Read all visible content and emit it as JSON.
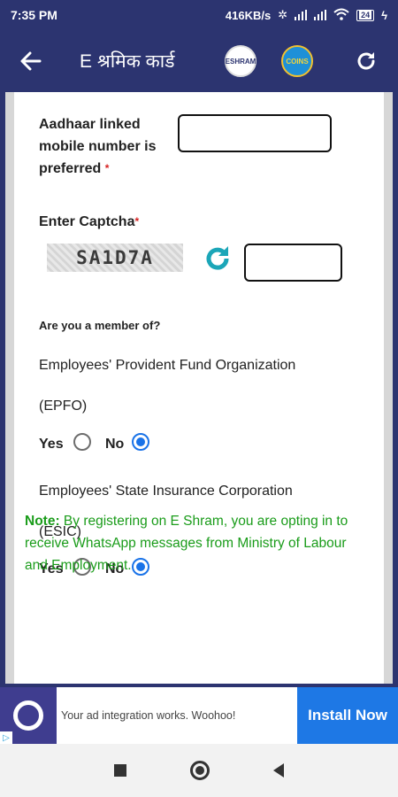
{
  "status_bar": {
    "time": "7:35 PM",
    "net_speed": "416KB/s",
    "battery": "24"
  },
  "app_bar": {
    "title": "E श्रमिक कार्ड",
    "logo_1_text": "ESHRAM",
    "logo_2_text": "COINS"
  },
  "form": {
    "mobile_label": "Aadhaar linked mobile number is preferred",
    "mobile_value": "",
    "captcha_label": "Enter Captcha",
    "captcha_text": "SA1D7A",
    "captcha_value": "",
    "member_question": "Are you a member of?",
    "epfo": {
      "title": "Employees' Provident Fund Organization",
      "abbr": "(EPFO)",
      "yes_label": "Yes",
      "no_label": "No",
      "selected": "No"
    },
    "esic": {
      "title": "Employees' State Insurance Corporation",
      "abbr": "(ESIC)",
      "yes_label": "Yes",
      "no_label": "No",
      "selected": "No"
    },
    "note_label": "Note:",
    "note_text": "By registering on E Shram, you are opting in to receive WhatsApp messages from Ministry of Labour and Employment."
  },
  "ad": {
    "text": "Your ad integration works. Woohoo!",
    "button": "Install Now"
  },
  "colors": {
    "primary": "#2c3470",
    "accent": "#1a73e8",
    "note_green": "#1a9c1a",
    "install_blue": "#1e78e5"
  }
}
